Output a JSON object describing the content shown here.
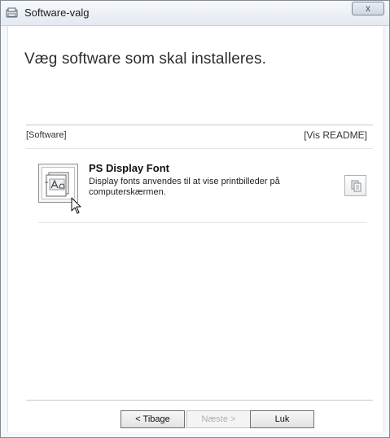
{
  "window": {
    "title": "Software-valg",
    "close_glyph": "x"
  },
  "heading": "Væg software som skal installeres.",
  "list": {
    "header_left": "[Software]",
    "header_right": "[Vis README]",
    "items": [
      {
        "name": "PS Display Font",
        "description": "Display fonts anvendes til at vise printbilleder på computerskærmen.",
        "icon": "ps-display-font-icon",
        "action_icon": "copy-icon"
      }
    ]
  },
  "buttons": {
    "back": "< Tibage",
    "next": "Næste >",
    "close": "Luk"
  },
  "colors": {
    "window_border": "#7d8a96",
    "text": "#2d2d2d",
    "disabled_text": "#b0b0b0"
  }
}
